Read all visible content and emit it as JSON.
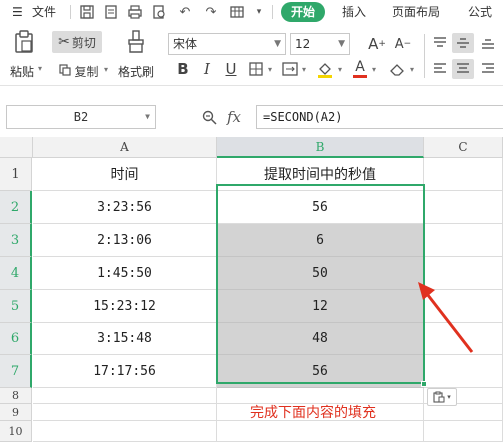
{
  "menu": {
    "file_label": "文件",
    "start_tab": "开始",
    "insert_tab": "插入",
    "page_layout_tab": "页面布局",
    "formula_tab": "公式"
  },
  "ribbon": {
    "cut_label": "剪切",
    "copy_label": "复制",
    "paste_label": "粘贴",
    "format_painter_label": "格式刷",
    "font_name": "宋体",
    "font_size": "12"
  },
  "formula_bar": {
    "name_box": "B2",
    "fx_label": "fx",
    "formula": "=SECOND(A2)"
  },
  "sheet": {
    "columns": [
      "A",
      "B",
      "C"
    ],
    "rows": [
      "1",
      "2",
      "3",
      "4",
      "5",
      "6",
      "7",
      "8",
      "9",
      "10"
    ],
    "header_a": "时间",
    "header_b": "提取时间中的秒值",
    "times": [
      "3:23:56",
      "2:13:06",
      "1:45:50",
      "15:23:12",
      "3:15:48",
      "17:17:56"
    ],
    "seconds": [
      "56",
      "6",
      "50",
      "12",
      "48",
      "56"
    ]
  },
  "annotation": {
    "text": "完成下面内容的填充"
  },
  "colors": {
    "accent": "#2fa86a",
    "fill_gray": "#d3d3d3",
    "annotation_red": "#e0311f"
  }
}
